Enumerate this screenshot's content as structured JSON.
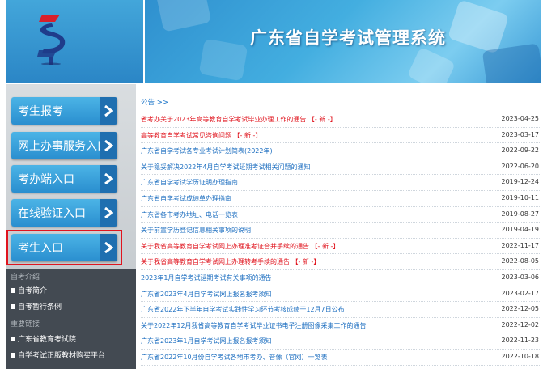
{
  "header": {
    "title": "广东省自学考试管理系统",
    "colors": {
      "banner": "#3ba3dc",
      "logo_red": "#d8202a",
      "logo_navy": "#1f3c8a"
    }
  },
  "sidebar": {
    "nav": [
      {
        "label": "考生报考"
      },
      {
        "label": "网上办事服务入口"
      },
      {
        "label": "考办端入口"
      },
      {
        "label": "在线验证入口"
      },
      {
        "label": "考生入口",
        "highlighted": true
      }
    ],
    "intro_heading": "自考介绍",
    "intro_links": [
      "自考简介",
      "自考暂行条例"
    ],
    "important_heading": "重要链接",
    "important_links": [
      "广东省教育考试院",
      "自学考试正版教材购买平台"
    ]
  },
  "main": {
    "breadcrumb": "公告 >>",
    "notices": [
      {
        "title": "省考办关于2023年高等教育自学考试毕业办理工作的通告  【- 新 -】",
        "date": "2023-04-25",
        "color": "red"
      },
      {
        "title": "高等教育自学考试常见咨询问题  【- 新 -】",
        "date": "2023-03-17",
        "color": "red"
      },
      {
        "title": "广东省自学考试各专业考试计划简表(2022年)",
        "date": "2022-09-22",
        "color": "blue"
      },
      {
        "title": "关于稳妥解决2022年4月自学考试延期考试相关问题的通知",
        "date": "2022-06-20",
        "color": "blue"
      },
      {
        "title": "广东省自学考试学历证明办理指南",
        "date": "2019-12-24",
        "color": "blue"
      },
      {
        "title": "广东省自学考试成绩单办理指南",
        "date": "2019-10-11",
        "color": "blue"
      },
      {
        "title": "广东省各市考办地址、电话一览表",
        "date": "2019-08-27",
        "color": "blue"
      },
      {
        "title": "关于前置学历登记信息相关事项的说明",
        "date": "2019-04-19",
        "color": "blue"
      },
      {
        "title": "关于我省高等教育自学考试网上办理准考证合并手续的通告  【- 新 -】",
        "date": "2022-11-17",
        "color": "red"
      },
      {
        "title": "关于我省高等教育自学考试网上办理转考手续的通告  【- 新 -】",
        "date": "2022-08-05",
        "color": "red"
      },
      {
        "title": "2023年1月自学考试延期考试有关事项的通告",
        "date": "2023-03-06",
        "color": "blue"
      },
      {
        "title": "广东省2023年4月自学考试网上报名报考须知",
        "date": "2023-02-17",
        "color": "blue"
      },
      {
        "title": "广东省2022年下半年自学考试实践性学习环节考核成绩于12月7日公布",
        "date": "2022-12-05",
        "color": "blue"
      },
      {
        "title": "关于2022年12月我省高等教育自学考试毕业证书电子注册图像采集工作的通告",
        "date": "2022-12-02",
        "color": "blue"
      },
      {
        "title": "广东省2023年1月自学考试网上报名报考须知",
        "date": "2022-11-23",
        "color": "blue"
      },
      {
        "title": "广东省2022年10月份自学考试各地市考办、音像（官网）一览表",
        "date": "2022-10-18",
        "color": "blue"
      }
    ]
  }
}
